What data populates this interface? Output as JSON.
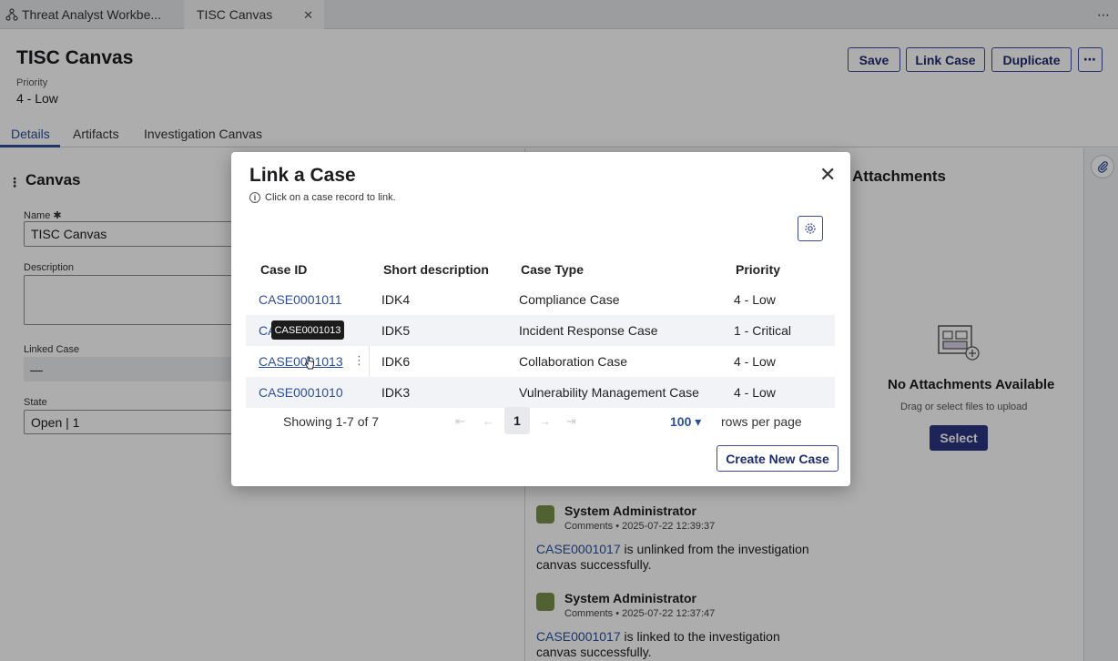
{
  "tabs": [
    {
      "label": "Threat Analyst Workbe...",
      "icon": "workflow-icon"
    },
    {
      "label": "TISC Canvas",
      "close": "✕"
    }
  ],
  "tabbar_more": "⋯",
  "header": {
    "title": "TISC Canvas",
    "priority_label": "Priority",
    "priority_value": "4 - Low",
    "buttons": {
      "save": "Save",
      "link_case": "Link Case",
      "duplicate": "Duplicate",
      "more": "⋯"
    }
  },
  "subtabs": [
    "Details",
    "Artifacts",
    "Investigation Canvas"
  ],
  "canvas_form": {
    "section_title": "Canvas",
    "name_label": "Name ✱",
    "name_value": "TISC Canvas",
    "description_label": "Description",
    "description_value": "",
    "linked_case_label": "Linked Case",
    "linked_case_value": "—",
    "state_label": "State",
    "state_value": "Open | 1"
  },
  "attachments": {
    "title": "Attachments",
    "empty_title": "No Attachments Available",
    "empty_sub": "Drag or select files to upload",
    "select_button": "Select"
  },
  "activity": [
    {
      "who": "System Administrator",
      "meta": "Comments • 2025-07-22 12:39:37",
      "case": "CASE0001017",
      "text": " is unlinked from the investigation canvas successfully."
    },
    {
      "who": "System Administrator",
      "meta": "Comments • 2025-07-22 12:37:47",
      "case": "CASE0001017",
      "text": " is linked to the investigation canvas successfully."
    }
  ],
  "modal": {
    "title": "Link a Case",
    "hint": "Click on a case record to link.",
    "columns": [
      "Case ID",
      "Short description",
      "Case Type",
      "Priority"
    ],
    "rows": [
      {
        "id": "CASE0001011",
        "desc": "IDK4",
        "type": "Compliance Case",
        "priority": "4 - Low"
      },
      {
        "id": "CA",
        "desc": "IDK5",
        "type": "Incident Response Case",
        "priority": "1 - Critical"
      },
      {
        "id": "CASE0001013",
        "desc": "IDK6",
        "type": "Collaboration Case",
        "priority": "4 - Low"
      },
      {
        "id": "CASE0001010",
        "desc": "IDK3",
        "type": "Vulnerability Management Case",
        "priority": "4 - Low"
      }
    ],
    "tooltip": "CASE0001013",
    "pagination": {
      "showing": "Showing 1-7 of 7",
      "page": "1",
      "page_size": "100",
      "rows_per_page": "rows per page"
    },
    "create_button": "Create New Case",
    "close": "✕"
  }
}
